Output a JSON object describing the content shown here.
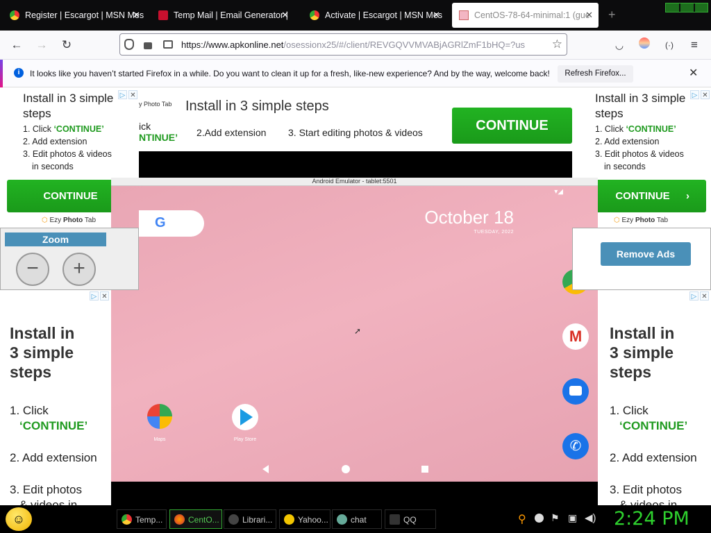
{
  "tabs": [
    {
      "title": "Register | Escargot | MSN Mes"
    },
    {
      "title": "Temp Mail | Email Generator |"
    },
    {
      "title": "Activate | Escargot | MSN Mes"
    },
    {
      "title": "CentOS-78-64-minimal:1 (gue"
    }
  ],
  "url": {
    "host": "https://www.apkonline.net",
    "rest": "/osessionx25/#/client/REVGQVVMVABjAGRlZmF1bHQ=?us"
  },
  "notification": {
    "text": "It looks like you haven’t started Firefox in a while. Do you want to clean it up for a fresh, like-new experience? And by the way, welcome back!",
    "button": "Refresh Firefox..."
  },
  "ad_small": {
    "title": "Install in 3 simple steps",
    "step1_prefix": "1. Click ",
    "step1_cta": "‘CONTINUE’",
    "step2": "2.  Add extension",
    "step3": "3. Edit photos & videos",
    "step3b": "in seconds",
    "button": "CONTINUE",
    "brand_prefix": "Ezy ",
    "brand_bold": "Photo",
    "brand_suffix": " Tab"
  },
  "ad_banner": {
    "title": "Install in 3 simple steps",
    "frag1": "ick",
    "frag2": "NTINUE’",
    "brand": "y Photo Tab",
    "step2": "2.Add extension",
    "step3": "3. Start editing photos & videos",
    "button": "CONTINUE"
  },
  "zoom": {
    "label": "Zoom",
    "minus": "−",
    "plus": "+"
  },
  "remove_ads": "Remove Ads",
  "ad_big": {
    "title_l1": "Install in",
    "title_l2": "3 simple",
    "title_l3": "steps",
    "step1": "1. Click",
    "step1_cta": "‘CONTINUE’",
    "step2": "2. Add extension",
    "step3": "3. Edit photos",
    "step3b": "& videos in"
  },
  "emulator": {
    "title": "Android Emulator - tablet:5501",
    "date": "October 18",
    "day": "TUESDAY, 2022",
    "apps": [
      {
        "label": "Maps"
      },
      {
        "label": "Play Store"
      }
    ]
  },
  "taskbar": {
    "items": [
      {
        "label": "Temp..."
      },
      {
        "label": "CentO..."
      },
      {
        "label": "Librari..."
      },
      {
        "label": "Yahoo..."
      },
      {
        "label": "chat"
      },
      {
        "label": "QQ"
      }
    ],
    "clock": "2:24 PM"
  }
}
